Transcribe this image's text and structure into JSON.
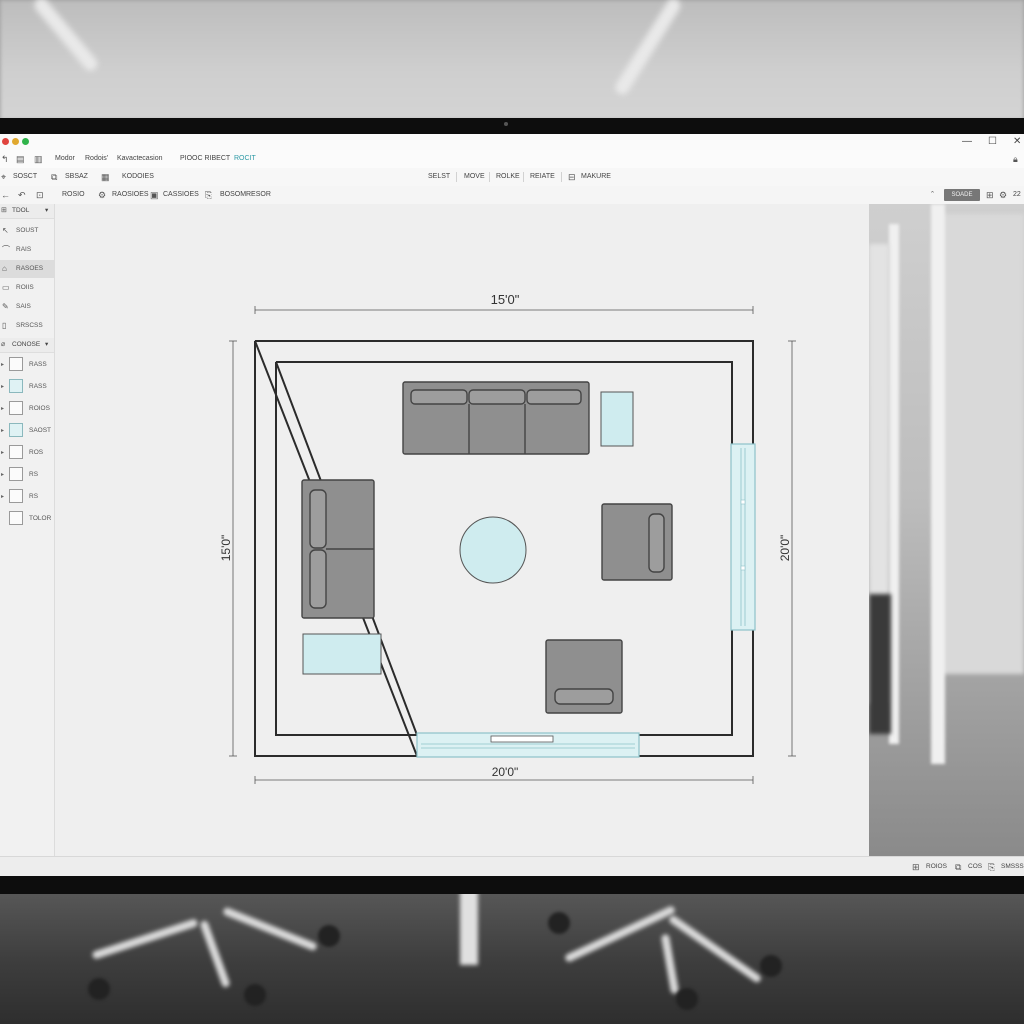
{
  "menubar": {
    "items": [
      "Modor",
      "Rodois'",
      "Kavactecasion",
      "PIOOC RIBECT",
      "ROCIT"
    ]
  },
  "toolbar_primary": {
    "left": [
      "SOSCT",
      "SBSAZ",
      "KODOIES"
    ],
    "modes": [
      "SELST",
      "MOVE",
      "ROLKE",
      "REIATE",
      "MAKURE"
    ]
  },
  "toolbar_secondary": {
    "items": [
      "ROSIO",
      "RAOSIOES",
      "CASSIOES",
      "BOSOM",
      "RESOR"
    ],
    "search_label": "SOADE",
    "zoom": "22"
  },
  "sidebar": {
    "tools_header": "TDOL",
    "tools": [
      "SOUST",
      "RAIS",
      "RASOES",
      "ROIIS",
      "SAIS",
      "SRSCSS"
    ],
    "layers_header": "CONOSE",
    "layers": [
      "RASS",
      "RASS",
      "ROIOS",
      "SAOST",
      "ROS",
      "RS",
      "RS",
      "TOLOR"
    ]
  },
  "plan": {
    "dim_top": "15'0\"",
    "dim_left": "15'0\"",
    "dim_right": "20'0\"",
    "dim_bottom": "20'0\""
  },
  "statusbar": {
    "items": [
      "ROIOS",
      "COS",
      "SMSSS"
    ]
  },
  "colors": {
    "furniture": "#8f8f8f",
    "furniture_dark": "#5a5a5a",
    "glass_tint": "#cfecef",
    "glass_stroke": "#8ec2c9",
    "wall": "#2b2b2b",
    "close_dot": "#e0443e",
    "min_dot": "#e0a82e",
    "max_dot": "#2fb34a"
  }
}
